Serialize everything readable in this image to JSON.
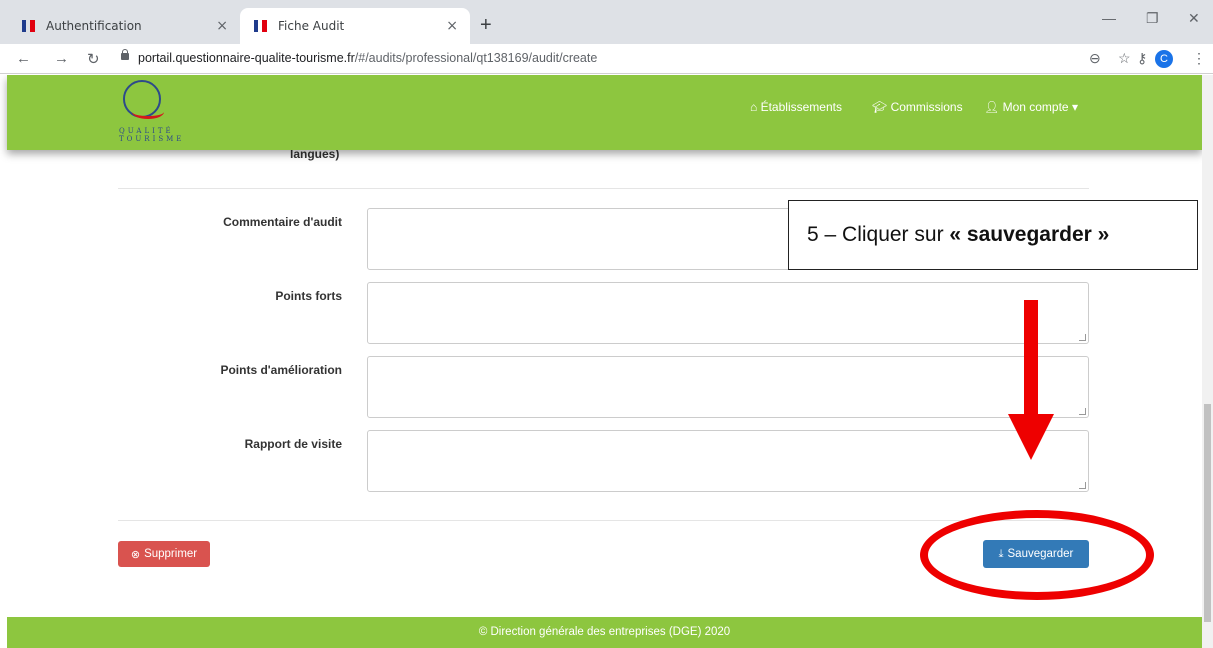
{
  "browser": {
    "tabs": [
      {
        "title": "Authentification",
        "close": "×"
      },
      {
        "title": "Fiche Audit",
        "close": "×"
      }
    ],
    "new_tab": "+",
    "url_host": "portail.questionnaire-qualite-tourisme.fr",
    "url_path": "/#/audits/professional/qt138169/audit/create",
    "profile_initial": "C"
  },
  "header": {
    "logo_text_line1": "QUALITÉ",
    "logo_text_line2": "TOURISME",
    "nav": {
      "etablissements": "Établissements",
      "commissions": "Commissions",
      "mon_compte": "Mon compte ▾"
    }
  },
  "form": {
    "cut_label": "langues)",
    "fields": [
      {
        "label": "Commentaire d'audit",
        "value": ""
      },
      {
        "label": "Points forts",
        "value": ""
      },
      {
        "label": "Points d'amélioration",
        "value": ""
      },
      {
        "label": "Rapport de visite",
        "value": ""
      }
    ],
    "delete_label": "Supprimer",
    "save_label": "Sauvegarder"
  },
  "footer": {
    "text": "© Direction générale des entreprises (DGE) 2020"
  },
  "annotation": {
    "prefix": "5 – Cliquer sur ",
    "emphasis": "« sauvegarder »"
  },
  "colors": {
    "header_green": "#8dc63f",
    "delete_red": "#d9534f",
    "save_blue": "#337ab7",
    "annotation_red": "#ee0000"
  }
}
